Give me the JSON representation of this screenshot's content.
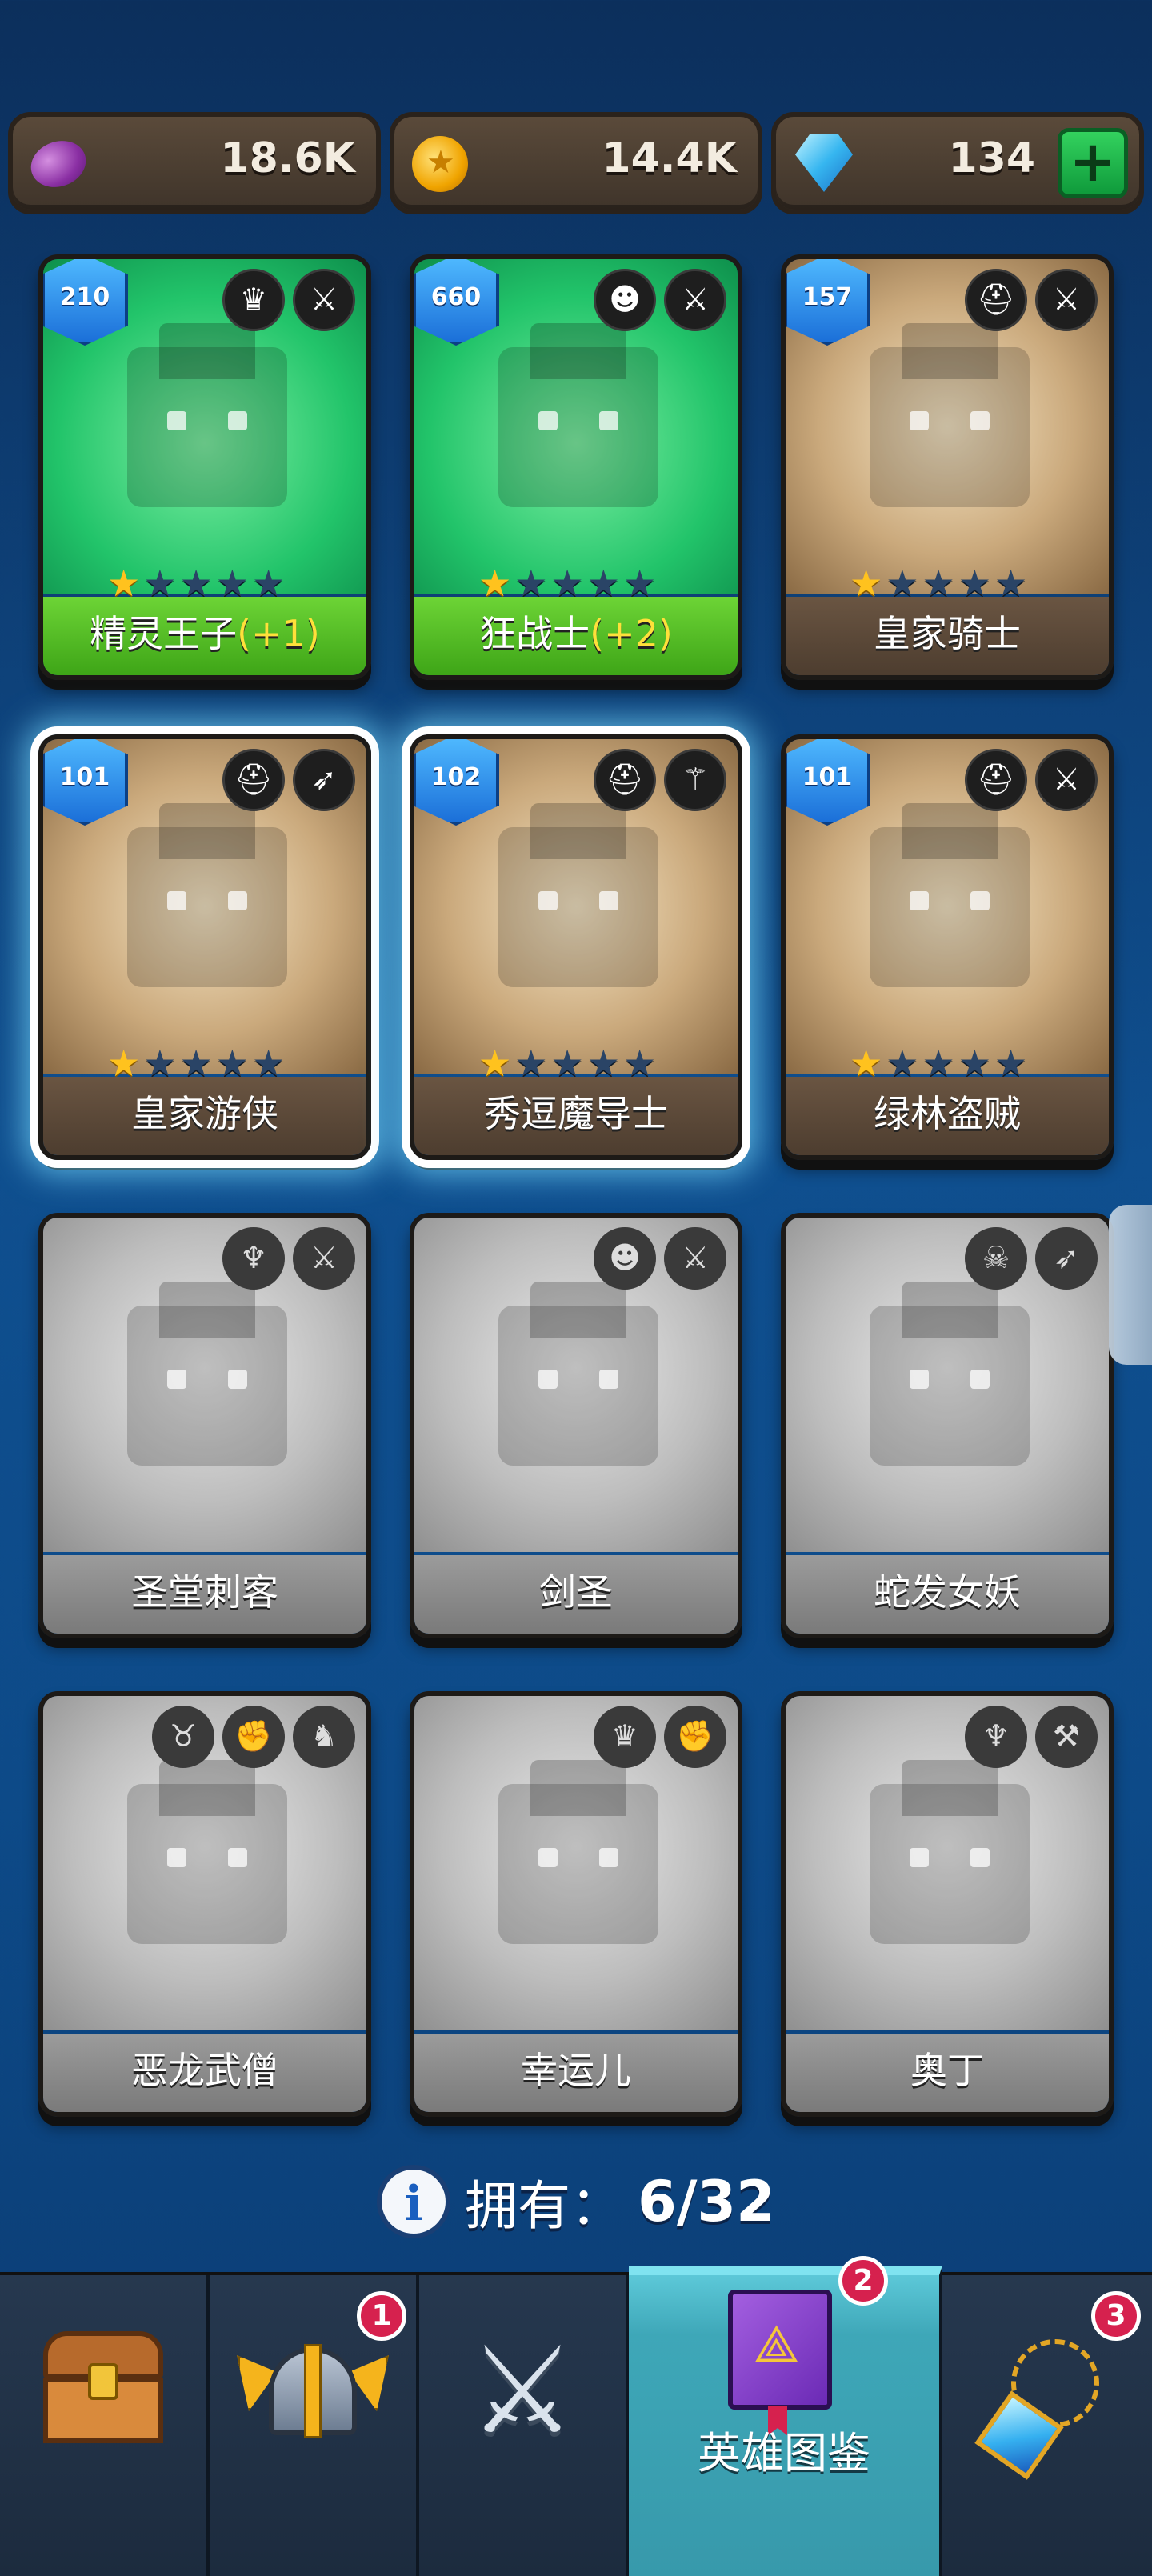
{
  "currency": {
    "elixir": {
      "value": "18.6K",
      "icon": "elixir-coin-icon",
      "color": "#9b3db5"
    },
    "gold": {
      "value": "14.4K",
      "icon": "gold-coin-icon",
      "color": "#f0a400"
    },
    "gems": {
      "value": "134",
      "icon": "gem-icon",
      "color": "#36b6f0",
      "add_label": "+"
    }
  },
  "heroes": [
    {
      "name": "精灵王子",
      "bonus": "(+1)",
      "level": "210",
      "stars": 1,
      "state": "new",
      "icons": [
        "elf-class-icon",
        "dagger-icon"
      ]
    },
    {
      "name": "狂战士",
      "bonus": "(+2)",
      "level": "660",
      "stars": 1,
      "state": "new",
      "icons": [
        "orc-class-icon",
        "sword-icon"
      ]
    },
    {
      "name": "皇家骑士",
      "bonus": "",
      "level": "157",
      "stars": 1,
      "state": "owned",
      "icons": [
        "helmet-class-icon",
        "sword-icon"
      ]
    },
    {
      "name": "皇家游侠",
      "bonus": "",
      "level": "101",
      "stars": 1,
      "state": "selected",
      "icons": [
        "helmet-class-icon",
        "bow-icon"
      ]
    },
    {
      "name": "秀逗魔导士",
      "bonus": "",
      "level": "102",
      "stars": 1,
      "state": "selected",
      "icons": [
        "helmet-class-icon",
        "staff-icon"
      ]
    },
    {
      "name": "绿林盗贼",
      "bonus": "",
      "level": "101",
      "stars": 1,
      "state": "owned",
      "icons": [
        "helmet-class-icon",
        "dagger-icon"
      ]
    },
    {
      "name": "圣堂刺客",
      "bonus": "",
      "level": "",
      "stars": 0,
      "state": "locked",
      "icons": [
        "angel-class-icon",
        "dagger-icon"
      ]
    },
    {
      "name": "剑圣",
      "bonus": "",
      "level": "",
      "stars": 0,
      "state": "locked",
      "icons": [
        "orc-class-icon",
        "sword-icon"
      ]
    },
    {
      "name": "蛇发女妖",
      "bonus": "",
      "level": "",
      "stars": 0,
      "state": "locked",
      "icons": [
        "skull-class-icon",
        "bow-icon"
      ]
    },
    {
      "name": "恶龙武僧",
      "bonus": "",
      "level": "",
      "stars": 0,
      "state": "locked",
      "icons": [
        "demon-class-icon",
        "fist-icon",
        "dragon-icon"
      ]
    },
    {
      "name": "幸运儿",
      "bonus": "",
      "level": "",
      "stars": 0,
      "state": "locked",
      "icons": [
        "elf-class-icon",
        "fist-icon"
      ]
    },
    {
      "name": "奥丁",
      "bonus": "",
      "level": "",
      "stars": 0,
      "state": "locked",
      "icons": [
        "angel-class-icon",
        "hammer-icon"
      ]
    }
  ],
  "owned": {
    "label": "拥有：",
    "value": "6/32",
    "icon": "info-icon"
  },
  "nav": {
    "items": [
      {
        "id": "chest",
        "label": "",
        "badge": ""
      },
      {
        "id": "heroes",
        "label": "",
        "badge": "1"
      },
      {
        "id": "battle",
        "label": "",
        "badge": ""
      },
      {
        "id": "codex",
        "label": "英雄图鉴",
        "badge": "2"
      },
      {
        "id": "items",
        "label": "",
        "badge": "3"
      }
    ]
  }
}
